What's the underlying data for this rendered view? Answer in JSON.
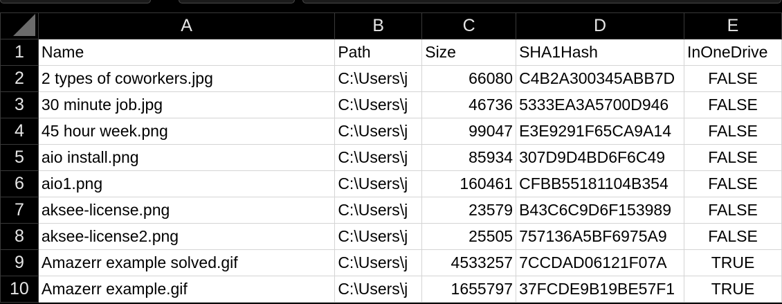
{
  "sheet": {
    "columns": [
      "A",
      "B",
      "C",
      "D",
      "E"
    ],
    "rows": [
      {
        "row": "1",
        "name": "Name",
        "path": "Path",
        "size": "Size",
        "hash": "SHA1Hash",
        "onedrive": "InOneDrive"
      },
      {
        "row": "2",
        "name": "2 types of coworkers.jpg",
        "path": "C:\\Users\\j",
        "size": "66080",
        "hash": "C4B2A300345ABB7D",
        "onedrive": "FALSE"
      },
      {
        "row": "3",
        "name": "30 minute job.jpg",
        "path": "C:\\Users\\j",
        "size": "46736",
        "hash": "5333EA3A5700D946",
        "onedrive": "FALSE"
      },
      {
        "row": "4",
        "name": "45 hour week.png",
        "path": "C:\\Users\\j",
        "size": "99047",
        "hash": "E3E9291F65CA9A14",
        "onedrive": "FALSE"
      },
      {
        "row": "5",
        "name": "aio install.png",
        "path": "C:\\Users\\j",
        "size": "85934",
        "hash": "307D9D4BD6F6C49",
        "onedrive": "FALSE"
      },
      {
        "row": "6",
        "name": "aio1.png",
        "path": "C:\\Users\\j",
        "size": "160461",
        "hash": "CFBB55181104B354",
        "onedrive": "FALSE"
      },
      {
        "row": "7",
        "name": "aksee-license.png",
        "path": "C:\\Users\\j",
        "size": "23579",
        "hash": "B43C6C9D6F153989",
        "onedrive": "FALSE"
      },
      {
        "row": "8",
        "name": "aksee-license2.png",
        "path": "C:\\Users\\j",
        "size": "25505",
        "hash": "757136A5BF6975A9",
        "onedrive": "FALSE"
      },
      {
        "row": "9",
        "name": "Amazerr example solved.gif",
        "path": "C:\\Users\\j",
        "size": "4533257",
        "hash": "7CCDAD06121F07A",
        "onedrive": "TRUE"
      },
      {
        "row": "10",
        "name": "Amazerr example.gif",
        "path": "C:\\Users\\j",
        "size": "1655797",
        "hash": "37FCDE9B19BE57F1",
        "onedrive": "TRUE"
      }
    ]
  }
}
